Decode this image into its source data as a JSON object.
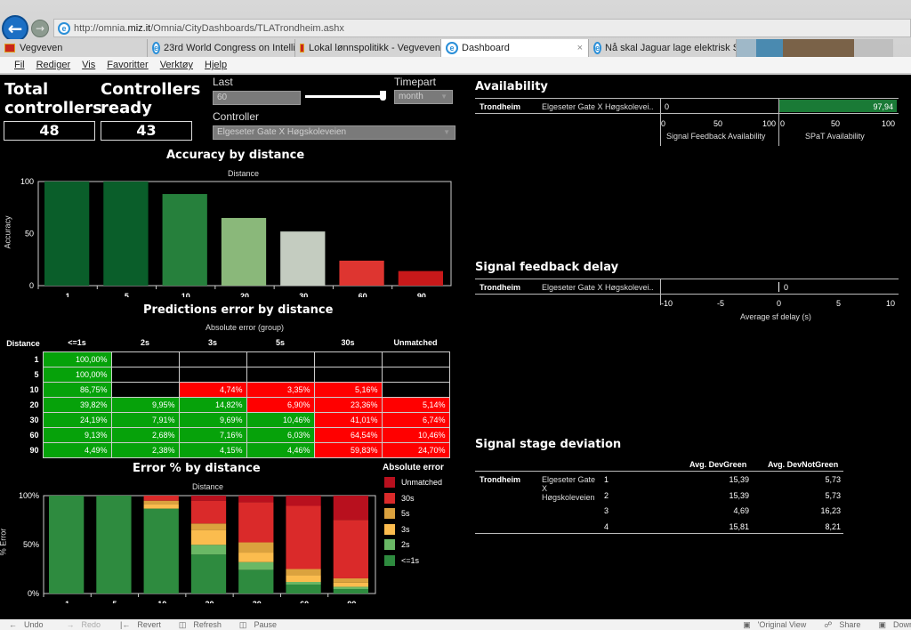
{
  "browser": {
    "url_prefix": "http://omnia.",
    "url_host": "miz.it",
    "url_path": "/Omnia/CityDashboards/TLATrondheim.ashx",
    "tabs": [
      {
        "label": "Vegveven",
        "icon": "vegvesen-flag-icon",
        "active": false
      },
      {
        "label": "23rd World Congress on Intelli...",
        "icon": "ie-icon",
        "active": false
      },
      {
        "label": "Lokal lønnspolitikk - Vegveven",
        "icon": "vegvesen-flag-icon",
        "active": false
      },
      {
        "label": "Dashboard",
        "icon": "ie-icon",
        "active": true
      },
      {
        "label": "Nå skal Jaguar lage elektrisk SUV",
        "icon": "ie-icon",
        "active": false
      }
    ],
    "menu": [
      "Fil",
      "Rediger",
      "Vis",
      "Favoritter",
      "Verktøy",
      "Hjelp"
    ]
  },
  "kpis": {
    "total_label_1": "Total",
    "total_label_2": "controllers",
    "total_value": "48",
    "ready_label_1": "Controllers",
    "ready_label_2": "ready",
    "ready_value": "43"
  },
  "filters": {
    "last_label": "Last",
    "last_value": "60",
    "slider_fraction": 1.0,
    "timepart_label": "Timepart",
    "timepart_value": "month",
    "controller_label": "Controller",
    "controller_value": "Elgeseter Gate X Høgskoleveien"
  },
  "accuracy_chart": {
    "title": "Accuracy by distance",
    "x_header": "Distance",
    "ylabel": "Accuracy"
  },
  "heat_table": {
    "title": "Predictions error by distance",
    "group_header": "Absolute error (group)",
    "row_header": "Distance",
    "columns": [
      "<=1s",
      "2s",
      "3s",
      "5s",
      "30s",
      "Unmatched"
    ],
    "rows": [
      {
        "distance": "1",
        "cells": [
          {
            "v": "100,00%",
            "c": "g"
          },
          {
            "v": "",
            "c": "e"
          },
          {
            "v": "",
            "c": "e"
          },
          {
            "v": "",
            "c": "e"
          },
          {
            "v": "",
            "c": "e"
          },
          {
            "v": "",
            "c": "e"
          }
        ]
      },
      {
        "distance": "5",
        "cells": [
          {
            "v": "100,00%",
            "c": "g"
          },
          {
            "v": "",
            "c": "e"
          },
          {
            "v": "",
            "c": "e"
          },
          {
            "v": "",
            "c": "e"
          },
          {
            "v": "",
            "c": "e"
          },
          {
            "v": "",
            "c": "e"
          }
        ]
      },
      {
        "distance": "10",
        "cells": [
          {
            "v": "86,75%",
            "c": "g"
          },
          {
            "v": "",
            "c": "e"
          },
          {
            "v": "4,74%",
            "c": "r"
          },
          {
            "v": "3,35%",
            "c": "r"
          },
          {
            "v": "5,16%",
            "c": "r"
          },
          {
            "v": "",
            "c": "e"
          }
        ]
      },
      {
        "distance": "20",
        "cells": [
          {
            "v": "39,82%",
            "c": "g"
          },
          {
            "v": "9,95%",
            "c": "g"
          },
          {
            "v": "14,82%",
            "c": "g"
          },
          {
            "v": "6,90%",
            "c": "r"
          },
          {
            "v": "23,36%",
            "c": "r"
          },
          {
            "v": "5,14%",
            "c": "r"
          }
        ]
      },
      {
        "distance": "30",
        "cells": [
          {
            "v": "24,19%",
            "c": "g"
          },
          {
            "v": "7,91%",
            "c": "g"
          },
          {
            "v": "9,69%",
            "c": "g"
          },
          {
            "v": "10,46%",
            "c": "g"
          },
          {
            "v": "41,01%",
            "c": "r"
          },
          {
            "v": "6,74%",
            "c": "r"
          }
        ]
      },
      {
        "distance": "60",
        "cells": [
          {
            "v": "9,13%",
            "c": "g"
          },
          {
            "v": "2,68%",
            "c": "g"
          },
          {
            "v": "7,16%",
            "c": "g"
          },
          {
            "v": "6,03%",
            "c": "g"
          },
          {
            "v": "64,54%",
            "c": "r"
          },
          {
            "v": "10,46%",
            "c": "r"
          }
        ]
      },
      {
        "distance": "90",
        "cells": [
          {
            "v": "4,49%",
            "c": "g"
          },
          {
            "v": "2,38%",
            "c": "g"
          },
          {
            "v": "4,15%",
            "c": "g"
          },
          {
            "v": "4,46%",
            "c": "g"
          },
          {
            "v": "59,83%",
            "c": "r"
          },
          {
            "v": "24,70%",
            "c": "r"
          }
        ]
      }
    ]
  },
  "error_chart": {
    "title": "Error % by distance",
    "x_header": "Distance",
    "ylabel": "% Error",
    "legend_title": "Absolute error"
  },
  "chart_data": [
    {
      "type": "bar",
      "title": "Accuracy by distance",
      "xlabel": "Distance",
      "ylabel": "Accuracy",
      "categories": [
        "1",
        "5",
        "10",
        "20",
        "30",
        "60",
        "90"
      ],
      "values": [
        100,
        100,
        88,
        65,
        52,
        24,
        14
      ],
      "colors": [
        "#0a5e2a",
        "#0a5e2a",
        "#26803c",
        "#8ab87a",
        "#c4ccc0",
        "#de3530",
        "#c8191a"
      ],
      "yticks": [
        "0",
        "50",
        "100"
      ],
      "ylim": [
        0,
        100
      ],
      "grid": false
    },
    {
      "type": "bar",
      "stacked": true,
      "title": "Error % by distance",
      "xlabel": "Distance",
      "ylabel": "% Error",
      "categories": [
        "1",
        "5",
        "10",
        "20",
        "30",
        "60",
        "90"
      ],
      "series": [
        {
          "name": "<=1s",
          "color": "#2e8b3f",
          "values": [
            100,
            100,
            86.75,
            39.82,
            24.19,
            9.13,
            4.49
          ]
        },
        {
          "name": "2s",
          "color": "#6ab865",
          "values": [
            0,
            0,
            0,
            9.95,
            7.91,
            2.68,
            2.38
          ]
        },
        {
          "name": "3s",
          "color": "#fbbc4e",
          "values": [
            0,
            0,
            4.74,
            14.82,
            9.69,
            7.16,
            4.15
          ]
        },
        {
          "name": "5s",
          "color": "#dba23e",
          "values": [
            0,
            0,
            3.35,
            6.9,
            10.46,
            6.03,
            4.46
          ]
        },
        {
          "name": "30s",
          "color": "#da2a2a",
          "values": [
            0,
            0,
            5.16,
            23.36,
            41.01,
            64.54,
            59.83
          ]
        },
        {
          "name": "Unmatched",
          "color": "#b8101e",
          "values": [
            0,
            0,
            0,
            5.14,
            6.74,
            10.46,
            24.7
          ]
        }
      ],
      "yticks": [
        "0%",
        "50%",
        "100%"
      ],
      "ylim": [
        0,
        100
      ],
      "legend": "right"
    },
    {
      "type": "bar",
      "orientation": "horizontal",
      "title": "Availability",
      "categories": [
        "Trondheim - Elgeseter Gate X Høgskolevei.."
      ],
      "series": [
        {
          "name": "Signal Feedback Availability",
          "values": [
            0
          ],
          "label": "0"
        },
        {
          "name": "SPaT Availability",
          "values": [
            97.94
          ],
          "label": "97,94",
          "color": "#1a7a36"
        }
      ],
      "xticks": [
        "0",
        "50",
        "100"
      ],
      "xlim": [
        0,
        100
      ]
    },
    {
      "type": "bar",
      "orientation": "horizontal",
      "title": "Signal feedback delay",
      "categories": [
        "Trondheim - Elgeseter Gate X Høgskolevei.."
      ],
      "values": [
        0
      ],
      "label": "0",
      "xlabel": "Average sf delay (s)",
      "xticks": [
        "-10",
        "-5",
        "0",
        "5",
        "10"
      ],
      "xlim": [
        -10,
        10
      ]
    }
  ],
  "availability": {
    "title": "Availability",
    "city": "Trondheim",
    "controller": "Elgeseter Gate X Høgskolevei..",
    "sf_value": "0",
    "spat_value": "97,94",
    "sf_axis_label": "Signal Feedback Availability",
    "spat_axis_label": "SPaT Availability",
    "ticks": [
      "0",
      "50",
      "100"
    ]
  },
  "sf_delay": {
    "title": "Signal feedback delay",
    "city": "Trondheim",
    "controller": "Elgeseter Gate X Høgskolevei..",
    "value": "0",
    "ticks": [
      "-10",
      "-5",
      "0",
      "5",
      "10"
    ],
    "axis_label": "Average sf delay (s)"
  },
  "stage_deviation": {
    "title": "Signal stage deviation",
    "col_green": "Avg. DevGreen",
    "col_notgreen": "Avg. DevNotGreen",
    "city": "Trondheim",
    "controller_l1": "Elgeseter Gate",
    "controller_l2": "X",
    "controller_l3": "Høgskoleveien",
    "rows": [
      {
        "stage": "1",
        "green": "15,39",
        "notgreen": "5,73"
      },
      {
        "stage": "2",
        "green": "15,39",
        "notgreen": "5,73"
      },
      {
        "stage": "3",
        "green": "4,69",
        "notgreen": "16,23"
      },
      {
        "stage": "4",
        "green": "15,81",
        "notgreen": "8,21"
      }
    ]
  },
  "toolbar": {
    "undo": "Undo",
    "redo": "Redo",
    "revert": "Revert",
    "refresh": "Refresh",
    "pause": "Pause",
    "original_view": "'Original View",
    "share": "Share",
    "download": "Download"
  }
}
